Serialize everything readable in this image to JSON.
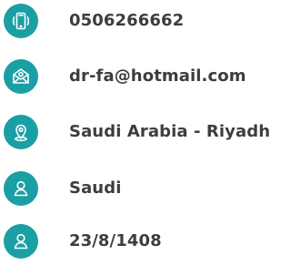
{
  "contact": {
    "items": [
      {
        "icon": "mobile-phone-icon",
        "value": "0506266662"
      },
      {
        "icon": "email-envelope-icon",
        "value": "dr-fa@hotmail.com"
      },
      {
        "icon": "location-pin-icon",
        "value": "Saudi Arabia - Riyadh"
      },
      {
        "icon": "user-icon",
        "value": "Saudi"
      },
      {
        "icon": "user-icon",
        "value": "23/8/1408"
      }
    ]
  },
  "colors": {
    "icon_background": "#1a9fa5",
    "text": "#3d3d3d"
  }
}
